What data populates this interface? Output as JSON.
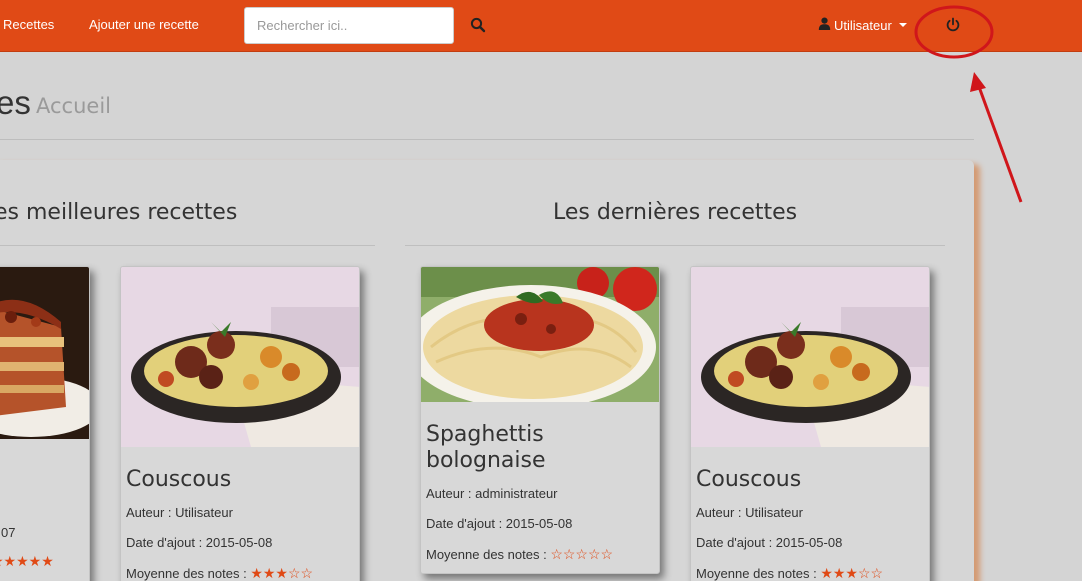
{
  "nav": {
    "recettes": "Recettes",
    "add_recipe": "Ajouter une recette",
    "search_placeholder": "Rechercher ici..",
    "user": "Utilisateur"
  },
  "header": {
    "title": "es",
    "subtitle": "Accueil"
  },
  "sections": {
    "best_title": "es meilleures recettes",
    "latest_title": "Les dernières recettes"
  },
  "cards": [
    {
      "title": "",
      "date_fragment": "07",
      "stars": "★★★★★"
    },
    {
      "title": "Couscous",
      "author": "Auteur : Utilisateur",
      "date": "Date d'ajout : 2015-05-08",
      "rating_label": "Moyenne des notes :",
      "stars": "★★★☆☆"
    },
    {
      "title": "Spaghettis bolognaise",
      "author": "Auteur : administrateur",
      "date": "Date d'ajout : 2015-05-08",
      "rating_label": "Moyenne des notes :",
      "stars": "☆☆☆☆☆"
    },
    {
      "title": "Couscous",
      "author": "Auteur : Utilisateur",
      "date": "Date d'ajout : 2015-05-08",
      "rating_label": "Moyenne des notes :",
      "stars": "★★★☆☆"
    }
  ],
  "colors": {
    "brand": "#e04a16",
    "annotation": "#d0161b"
  },
  "icons": [
    "user-icon",
    "search-icon",
    "power-icon",
    "caret-down-icon",
    "star-icon"
  ]
}
